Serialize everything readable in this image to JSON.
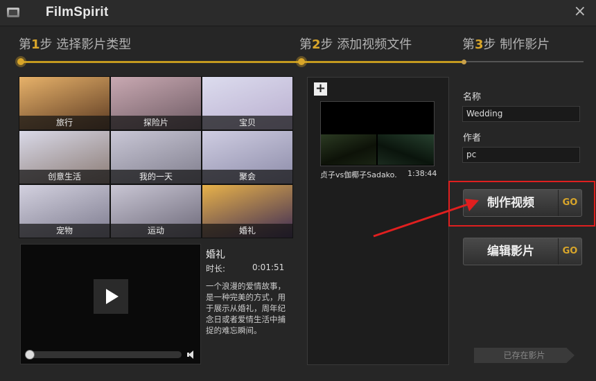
{
  "window": {
    "title": "FilmSpirit",
    "close_icon": "×"
  },
  "steps": [
    {
      "prefix": "第",
      "num": "1",
      "suffix": "步 选择影片类型"
    },
    {
      "prefix": "第",
      "num": "2",
      "suffix": "步 添加视频文件"
    },
    {
      "prefix": "第",
      "num": "3",
      "suffix": "步 制作影片"
    }
  ],
  "categories": [
    {
      "label": "旅行",
      "colors": [
        "#e7b26a",
        "#5c3a22"
      ]
    },
    {
      "label": "探险片",
      "colors": [
        "#c9a9b2",
        "#6d5a63"
      ]
    },
    {
      "label": "宝贝",
      "colors": [
        "#dcdcee",
        "#b9aecf"
      ]
    },
    {
      "label": "创意生活",
      "colors": [
        "#d9d9e8",
        "#8a7a73"
      ]
    },
    {
      "label": "我的一天",
      "colors": [
        "#c9c7d6",
        "#7f7d8c"
      ]
    },
    {
      "label": "聚会",
      "colors": [
        "#cfcde2",
        "#8c8ba8"
      ]
    },
    {
      "label": "宠物",
      "colors": [
        "#d3d1df",
        "#7d7b8e"
      ]
    },
    {
      "label": "运动",
      "colors": [
        "#c9c6d4",
        "#6c6878"
      ]
    },
    {
      "label": "婚礼",
      "colors": [
        "#e8b24a",
        "#3b2a55"
      ]
    }
  ],
  "selected_category": "婚礼",
  "description": {
    "title": "婚礼",
    "duration_label": "时长:",
    "duration_value": "0:01:51",
    "text": "一个浪漫的爱情故事，是一种完美的方式，用于展示从婚礼，周年纪念日或者爱情生活中捕捉的难忘瞬间。"
  },
  "files": {
    "add_label": "+",
    "items": [
      {
        "name": "贞子vs伽椰子Sadako...",
        "duration": "1:38:44"
      }
    ]
  },
  "right_panel": {
    "name_label": "名称",
    "name_value": "Wedding",
    "author_label": "作者",
    "author_value": "pc",
    "make_video_label": "制作视频",
    "edit_movie_label": "编辑影片",
    "go_label": "GO",
    "existing_label": "已存在影片"
  },
  "colors": {
    "accent": "#d9a62a",
    "highlight": "#e01f1f"
  }
}
